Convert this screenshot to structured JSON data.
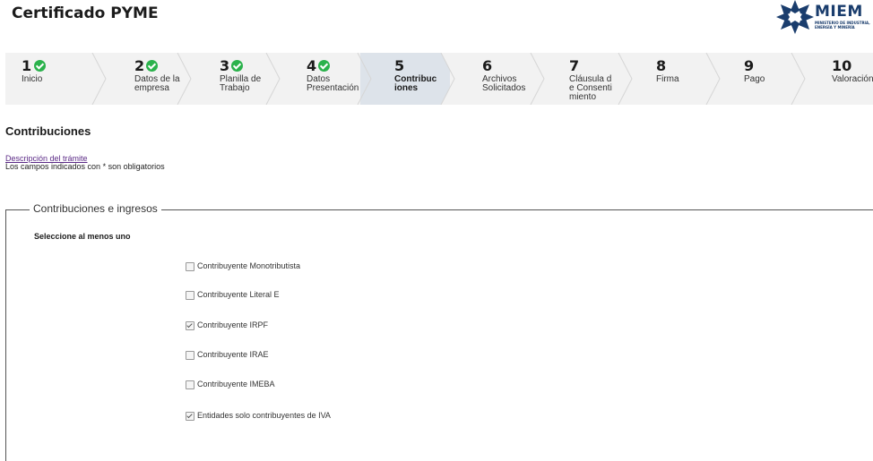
{
  "header": {
    "title": "Certificado PYME",
    "logo_text": "MIEM",
    "logo_sub": "MINISTERIO DE INDUSTRIA, ENERGÍA Y MINERÍA"
  },
  "steps": [
    {
      "num": "1",
      "label": "Inicio",
      "done": true
    },
    {
      "num": "2",
      "label": "Datos de la empresa",
      "done": true
    },
    {
      "num": "3",
      "label": "Planilla de Trabajo",
      "done": true
    },
    {
      "num": "4",
      "label": "Datos Presentación",
      "done": true
    },
    {
      "num": "5",
      "label": "Contribuciones",
      "done": false,
      "active": true
    },
    {
      "num": "6",
      "label": "Archivos Solicitados",
      "done": false
    },
    {
      "num": "7",
      "label": "Cláusula de Consentimiento",
      "done": false
    },
    {
      "num": "8",
      "label": "Firma",
      "done": false
    },
    {
      "num": "9",
      "label": "Pago",
      "done": false
    },
    {
      "num": "10",
      "label": "Valoración",
      "done": false
    }
  ],
  "section": {
    "title": "Contribuciones",
    "desc_link": "Descripción del trámite",
    "required_note": "Los campos indicados con * son obligatorios"
  },
  "fieldset": {
    "legend": "Contribuciones e ingresos",
    "label": "Seleccione al menos uno",
    "options": [
      {
        "label": "Contribuyente Monotributista",
        "checked": false
      },
      {
        "label": "Contribuyente Literal E",
        "checked": false
      },
      {
        "label": "Contribuyente IRPF",
        "checked": true
      },
      {
        "label": "Contribuyente IRAE",
        "checked": false
      },
      {
        "label": "Contribuyente IMEBA",
        "checked": false
      },
      {
        "label": "Entidades solo contribuyentes de IVA",
        "checked": true
      }
    ]
  },
  "colors": {
    "check_green": "#2bb24c",
    "active_step_bg": "#dde3ea",
    "link": "#5b2a86",
    "brand": "#1a3d6d"
  }
}
